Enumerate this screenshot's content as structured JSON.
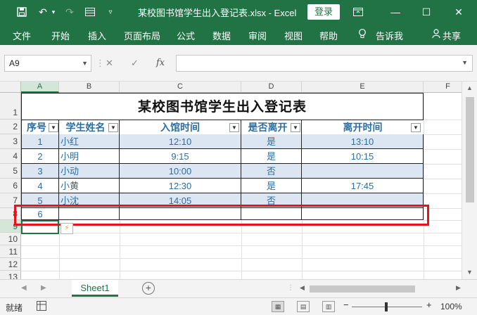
{
  "window": {
    "title": "某校图书馆学生出入登记表.xlsx  -  Excel",
    "login_label": "登录",
    "accent": "#217346"
  },
  "ribbon": {
    "tabs": [
      "文件",
      "开始",
      "插入",
      "页面布局",
      "公式",
      "数据",
      "审阅",
      "视图",
      "帮助"
    ],
    "tell_me": "告诉我",
    "share": "共享"
  },
  "formula_bar": {
    "name_box": "A9",
    "fx_label": "fx",
    "formula": ""
  },
  "grid": {
    "columns": [
      "A",
      "B",
      "C",
      "D",
      "E",
      "F"
    ],
    "selected_column": "A",
    "rows": [
      "1",
      "2",
      "3",
      "4",
      "5",
      "6",
      "7",
      "8",
      "9",
      "10",
      "11",
      "12",
      "13"
    ],
    "selected_row": "9",
    "sheet_title": "某校图书馆学生出入登记表",
    "headers": [
      "序号",
      "学生姓名",
      "入馆时间",
      "是否离开",
      "离开时间"
    ],
    "records": [
      [
        "1",
        "小红",
        "12:10",
        "是",
        "13:10"
      ],
      [
        "2",
        "小明",
        "9:15",
        "是",
        "10:15"
      ],
      [
        "3",
        "小动",
        "10:00",
        "否",
        ""
      ],
      [
        "4",
        "小黄",
        "12:30",
        "是",
        "17:45"
      ],
      [
        "5",
        "小沈",
        "14:05",
        "否",
        ""
      ],
      [
        "6",
        "",
        "",
        "",
        ""
      ]
    ],
    "band_color": "#dce6f2",
    "highlight_color": "#e8121a"
  },
  "sheet_tabs": {
    "active": "Sheet1"
  },
  "status_bar": {
    "ready": "就绪",
    "zoom": "100%"
  }
}
